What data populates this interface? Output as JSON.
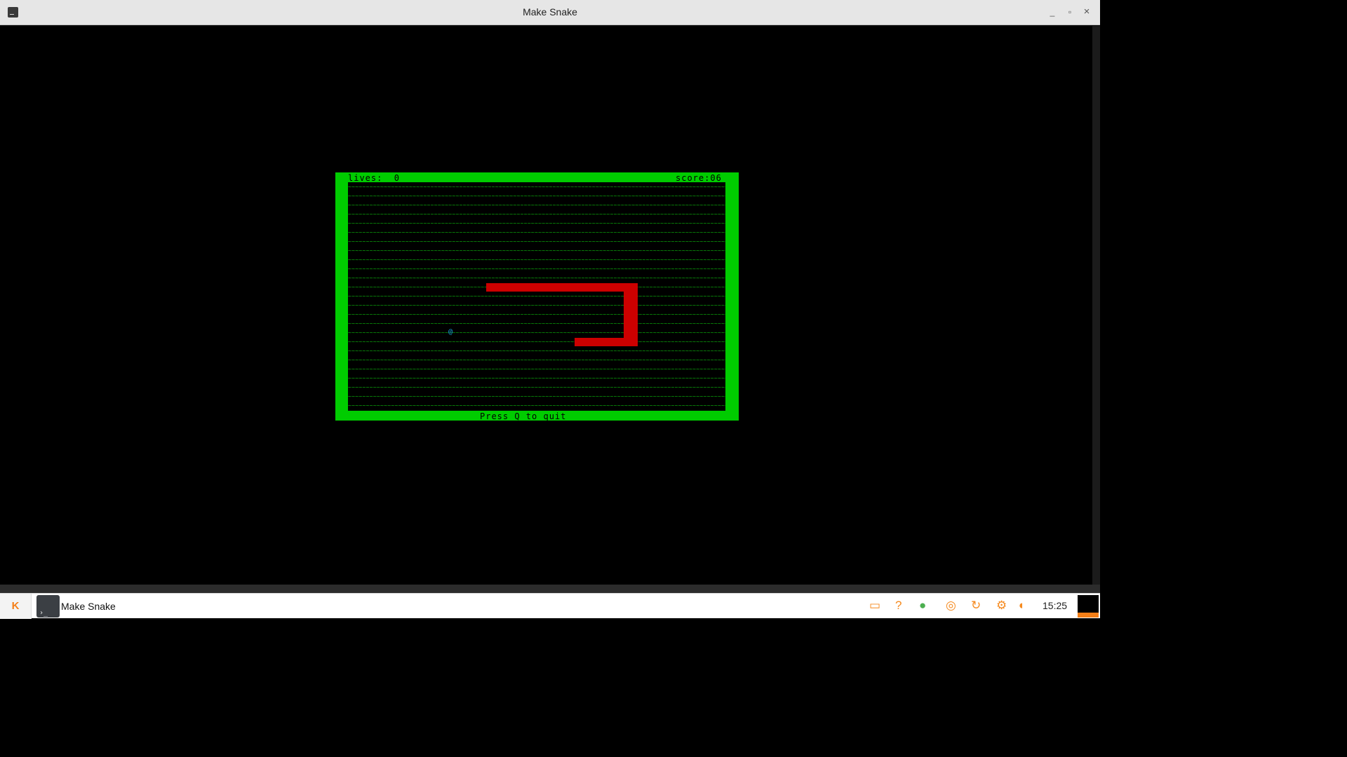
{
  "window": {
    "title": "Make Snake",
    "min_glyph": "_",
    "max_glyph": "▫",
    "close_glyph": "×"
  },
  "game": {
    "lives_text": "lives:  0",
    "score_text": "score:06",
    "footer_text": "Press Q to quit",
    "food_glyph": "@",
    "background_glyph": "~",
    "snake_color": "#cc0000",
    "border_color": "#00cc00",
    "grass_color": "#0db60d",
    "food_color": "#1aa8e8"
  },
  "taskbar": {
    "start_label": "K",
    "task_label": "Make Snake",
    "clock": "15:25",
    "tray_icons": [
      "display-icon",
      "help-icon",
      "user-status-icon",
      "network-icon",
      "updater-icon",
      "settings-icon",
      "volume-icon"
    ],
    "tray_glyphs": [
      "▭",
      "?",
      "●",
      "◎",
      "↻",
      "⚙",
      "◖"
    ]
  }
}
